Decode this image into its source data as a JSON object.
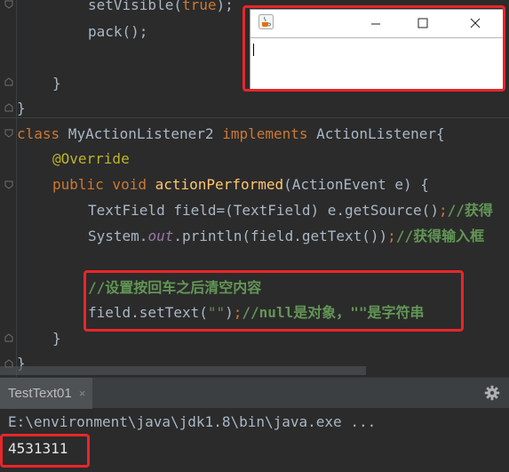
{
  "editor": {
    "lines": {
      "l1": {
        "a": "setVisible(",
        "kw": "true",
        "b": ");"
      },
      "l2": "pack();",
      "l3": "}",
      "l4": "}",
      "l5": {
        "kw1": "class",
        "a": " MyActionListener2 ",
        "kw2": "implements",
        "b": " ActionListener{"
      },
      "l6": "@Override",
      "l7": {
        "kw": "public void",
        "sp": " ",
        "fn": "actionPerformed",
        "b": "(ActionEvent e) {"
      },
      "l8": {
        "a": "TextField field=(TextField) e.getSource()",
        "semi": ";",
        "cmt": "//获得"
      },
      "l9": {
        "a": "System.",
        "st": "out",
        "b": ".println(field.getText())",
        "semi": ";",
        "cmt": "//获得输入框"
      },
      "l10": "//设置按回车之后清空内容",
      "l11": {
        "a": "field.setText(",
        "str": "\"\"",
        "b": ")",
        "semi": ";",
        "cmt": "//null是对象，\"\"是字符串"
      },
      "l12": "}",
      "l13": "}"
    }
  },
  "run": {
    "tab_label": "TestText01",
    "tab_close": "×",
    "command": "E:\\environment\\java\\jdk1.8\\bin\\java.exe ...",
    "output": "4531311"
  },
  "colors": {
    "highlight": "#e8262a",
    "background": "#2b2b2b"
  }
}
